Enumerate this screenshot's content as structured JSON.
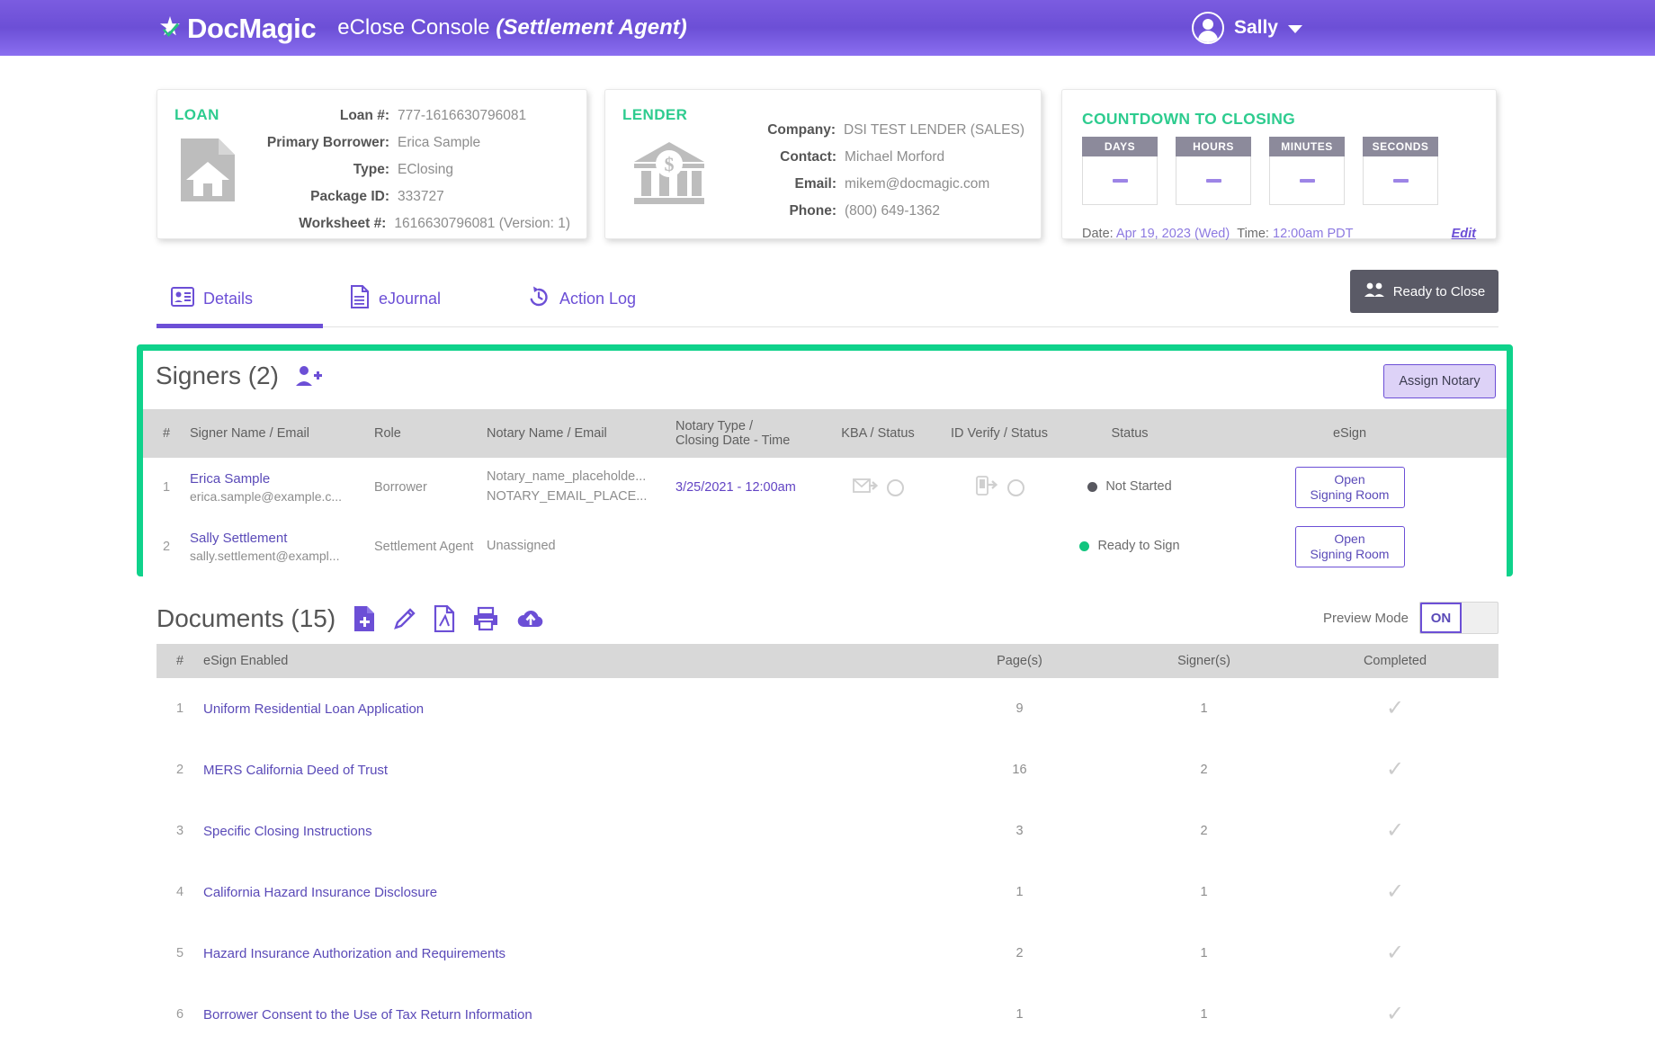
{
  "header": {
    "brand": "DocMagic",
    "console_title": "eClose Console ",
    "console_role": "(Settlement Agent)",
    "user_name": "Sally",
    "brand_color": "#6c4fd6"
  },
  "loan_card": {
    "heading": "LOAN",
    "rows": [
      {
        "label": "Loan #:",
        "value": "777-1616630796081"
      },
      {
        "label": "Primary Borrower:",
        "value": "Erica Sample"
      },
      {
        "label": "Type:",
        "value": "EClosing"
      },
      {
        "label": "Package ID:",
        "value": "333727"
      },
      {
        "label": "Worksheet #:",
        "value": "1616630796081 (Version: 1)"
      }
    ]
  },
  "lender_card": {
    "heading": "LENDER",
    "rows": [
      {
        "label": "Company:",
        "value": "DSI TEST LENDER (SALES)"
      },
      {
        "label": "Contact:",
        "value": "Michael Morford"
      },
      {
        "label": "Email:",
        "value": "mikem@docmagic.com"
      },
      {
        "label": "Phone:",
        "value": "(800) 649-1362"
      }
    ]
  },
  "countdown_card": {
    "heading": "COUNTDOWN TO CLOSING",
    "units": [
      {
        "label": "DAYS",
        "value": "-"
      },
      {
        "label": "HOURS",
        "value": "-"
      },
      {
        "label": "MINUTES",
        "value": "-"
      },
      {
        "label": "SECONDS",
        "value": "-"
      }
    ],
    "date_label": "Date:",
    "date_value": "Apr 19, 2023 (Wed)",
    "time_label": "Time:",
    "time_value": "12:00am PDT",
    "edit_label": "Edit"
  },
  "tabs": {
    "items": [
      {
        "label": "Details",
        "icon": "id-card-icon",
        "active": true
      },
      {
        "label": "eJournal",
        "icon": "document-icon",
        "active": false
      },
      {
        "label": "Action Log",
        "icon": "history-icon",
        "active": false
      }
    ],
    "ready_button": "Ready to Close"
  },
  "signers": {
    "title": "Signers (2)",
    "add_icon": "add-user-icon",
    "assign_button": "Assign Notary",
    "columns": [
      "#",
      "Signer Name / Email",
      "Role",
      "Notary Name / Email",
      "Notary Type /\nClosing Date - Time",
      "KBA / Status",
      "ID Verify / Status",
      "Status",
      "eSign"
    ],
    "col_notary_type_line1": "Notary Type /",
    "col_notary_type_line2": "Closing Date - Time",
    "rows": [
      {
        "num": "1",
        "name": "Erica Sample",
        "email": "erica.sample@example.c...",
        "role": "Borrower",
        "notary_name": "Notary_name_placeholde...",
        "notary_email": "NOTARY_EMAIL_PLACE...",
        "closing_date": "3/25/2021 - 12:00am",
        "has_kba": true,
        "has_idverify": true,
        "status": "Not Started",
        "status_color": "#58585f",
        "esign_line1": "Open",
        "esign_line2": "Signing Room"
      },
      {
        "num": "2",
        "name": "Sally Settlement",
        "email": "sally.settlement@exampl...",
        "role": "Settlement Agent",
        "notary_name": "Unassigned",
        "notary_email": "",
        "closing_date": "",
        "has_kba": false,
        "has_idverify": false,
        "status": "Ready to Sign",
        "status_color": "#12c57e",
        "esign_line1": "Open",
        "esign_line2": "Signing Room"
      }
    ],
    "highlight_color": "#0fd28b"
  },
  "documents": {
    "title": "Documents (15)",
    "toolbar_icons": [
      "add-document-icon",
      "edit-pencil-icon",
      "pdf-icon",
      "print-icon",
      "upload-cloud-icon"
    ],
    "preview_label": "Preview Mode",
    "preview_state": "ON",
    "columns": [
      "#",
      "eSign Enabled",
      "Page(s)",
      "Signer(s)",
      "Completed"
    ],
    "rows": [
      {
        "num": "1",
        "name": "Uniform Residential Loan Application",
        "pages": "9",
        "signers": "1",
        "completed": "✓"
      },
      {
        "num": "2",
        "name": "MERS California Deed of Trust",
        "pages": "16",
        "signers": "2",
        "completed": "✓"
      },
      {
        "num": "3",
        "name": "Specific Closing Instructions",
        "pages": "3",
        "signers": "2",
        "completed": "✓"
      },
      {
        "num": "4",
        "name": "California Hazard Insurance Disclosure",
        "pages": "1",
        "signers": "1",
        "completed": "✓"
      },
      {
        "num": "5",
        "name": "Hazard Insurance Authorization and Requirements",
        "pages": "2",
        "signers": "1",
        "completed": "✓"
      },
      {
        "num": "6",
        "name": "Borrower Consent to the Use of Tax Return Information",
        "pages": "1",
        "signers": "1",
        "completed": "✓"
      }
    ]
  }
}
